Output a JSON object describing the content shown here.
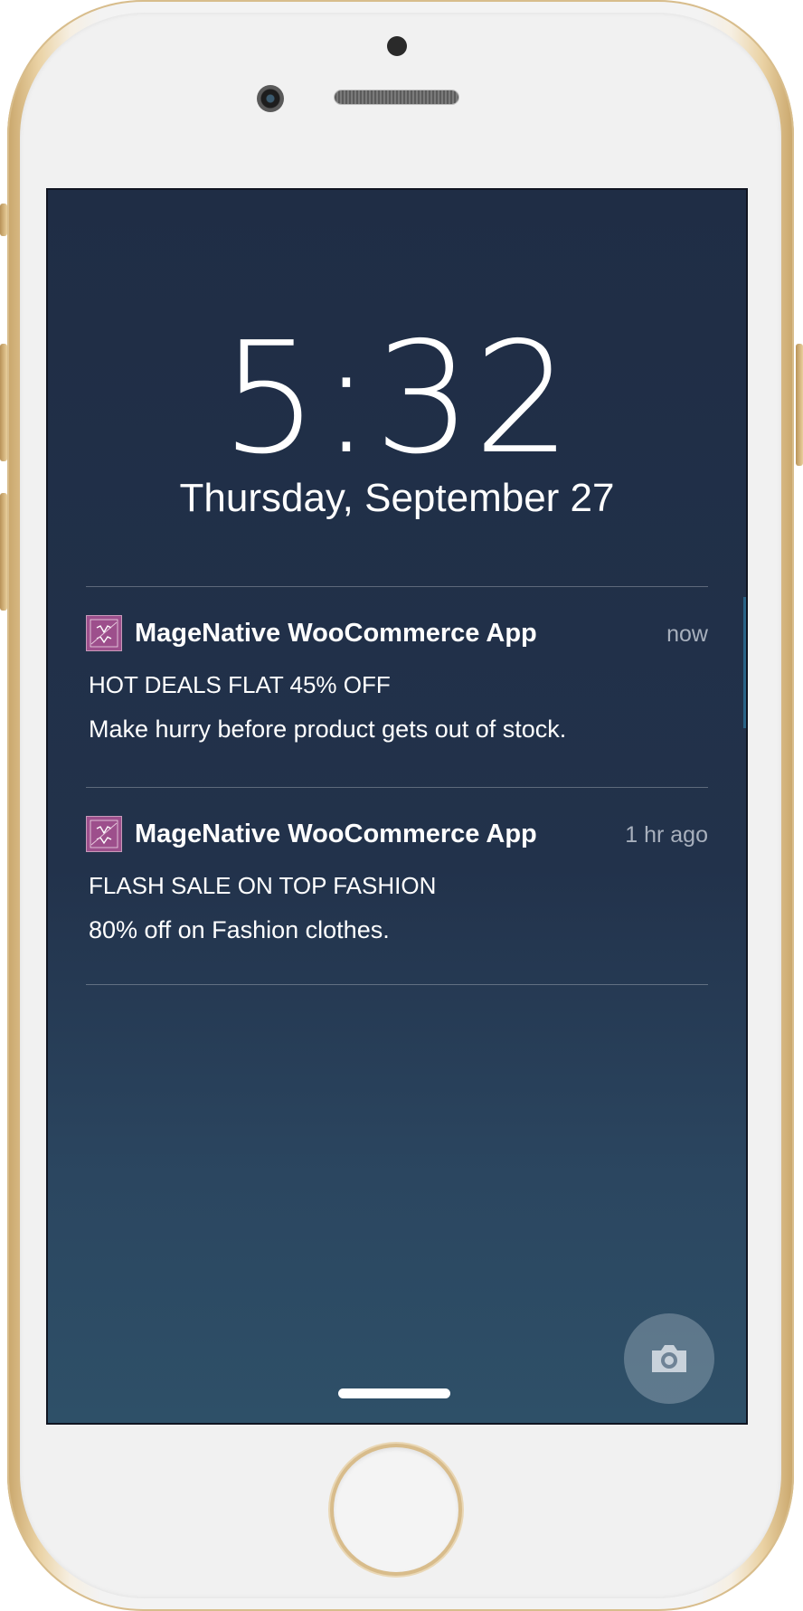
{
  "lockscreen": {
    "time": "5:32",
    "date": "Thursday, September 27"
  },
  "notifications": [
    {
      "app_name": "MageNative WooCommerce App",
      "time_ago": "now",
      "title": "HOT DEALS FLAT 45% OFF",
      "body": "Make hurry before product gets out of stock.",
      "icon": "magenative-app-icon"
    },
    {
      "app_name": "MageNative WooCommerce App",
      "time_ago": "1 hr ago",
      "title": "FLASH SALE ON TOP FASHION",
      "body": "80% off on Fashion clothes.",
      "icon": "magenative-app-icon"
    }
  ],
  "icons": {
    "camera": "camera-icon",
    "home": "home-button"
  },
  "colors": {
    "screen_top": "#1f2d45",
    "screen_bottom": "#2e5068",
    "app_icon": "#9d4f8c",
    "phone_gold": "#d8bc8b"
  }
}
